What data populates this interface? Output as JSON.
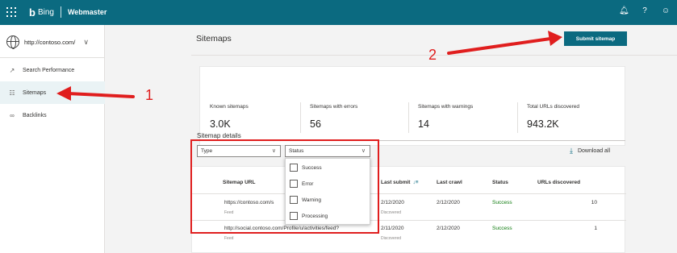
{
  "header": {
    "brand": "Bing",
    "product": "Webmaster",
    "icons": [
      "waffle-icon",
      "bell-icon",
      "help-icon",
      "smiley-icon"
    ],
    "help_glyph": "?"
  },
  "sidebar": {
    "site_url": "http://contoso.com/",
    "items": [
      {
        "label": "Search Performance",
        "icon": "trend-icon",
        "active": false
      },
      {
        "label": "Sitemaps",
        "icon": "sitemap-icon",
        "active": true
      },
      {
        "label": "Backlinks",
        "icon": "link-icon",
        "active": false
      }
    ]
  },
  "main": {
    "title": "Sitemaps",
    "submit_label": "Submit sitemap",
    "stats": [
      {
        "label": "Known sitemaps",
        "value": "3.0K"
      },
      {
        "label": "Sitemaps with errors",
        "value": "56"
      },
      {
        "label": "Sitemaps with warnings",
        "value": "14"
      },
      {
        "label": "Total URLs discovered",
        "value": "943.2K"
      }
    ],
    "details_label": "Sitemap details",
    "filters": {
      "type_placeholder": "Type",
      "status_placeholder": "Status",
      "status_options": [
        "Success",
        "Error",
        "Warning",
        "Processing"
      ]
    },
    "download_label": "Download all",
    "table": {
      "columns": [
        "Sitemap URL",
        "Last submit",
        "Last crawl",
        "Status",
        "URLs discovered"
      ],
      "rows": [
        {
          "url": "https://contoso.com/s",
          "kind": "Feed",
          "last_submit": "2/12/2020",
          "submit_note": "Discovered",
          "last_crawl": "2/12/2020",
          "status": "Success",
          "urls": "10"
        },
        {
          "url": "http://social.contoso.com/Profile/u/activities/feed?",
          "kind": "Feed",
          "last_submit": "2/11/2020",
          "submit_note": "Discovered",
          "last_crawl": "2/12/2020",
          "status": "Success",
          "urls": "1"
        }
      ]
    }
  },
  "annotations": {
    "step1": "1",
    "step2": "2",
    "color": "#e01e1e"
  },
  "colors": {
    "accent": "#0b6a80",
    "success": "#107c10"
  }
}
